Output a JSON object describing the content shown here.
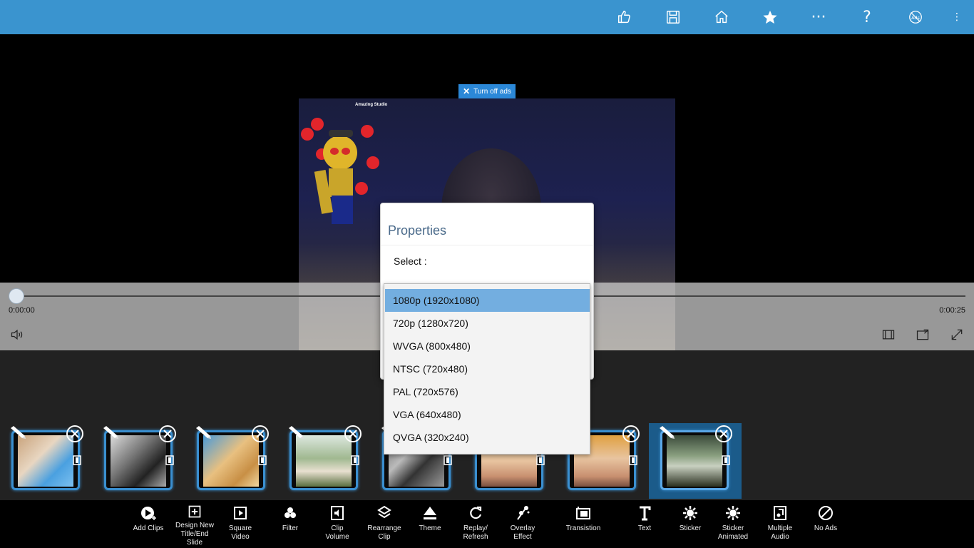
{
  "titlebar": {
    "buttons": [
      "like",
      "save",
      "home",
      "favorite",
      "more",
      "help",
      "ads-free",
      "overflow"
    ],
    "more_text": "···",
    "help_text": "?",
    "overflow_text": "⋮"
  },
  "stage": {
    "ads_button_label": "Turn off ads",
    "sticker_label": "Amazing Studio"
  },
  "player": {
    "time_current": "0:00:00",
    "time_total": "0:00:25"
  },
  "dialog": {
    "title": "Properties",
    "select_label": "Select :",
    "options": [
      "1080p (1920x1080)",
      "720p (1280x720)",
      "WVGA (800x480)",
      "NTSC (720x480)",
      "PAL (720x576)",
      "VGA (640x480)",
      "QVGA (320x240)"
    ],
    "selected_index": 0
  },
  "timeline": {
    "clip_count": 8,
    "selected_index": 7
  },
  "toolbar": {
    "items": [
      {
        "label": "Add Clips"
      },
      {
        "label": "Design New\nTitle/End\nSlide"
      },
      {
        "label": "Square\nVideo"
      },
      {
        "label": "Filter"
      },
      {
        "label": "Clip\nVolume"
      },
      {
        "label": "Rearrange\nClip"
      },
      {
        "label": "Theme"
      },
      {
        "label": "Replay/\nRefresh"
      },
      {
        "label": "Overlay\nEffect"
      },
      {
        "label": "Transistion"
      },
      {
        "label": "Text"
      },
      {
        "label": "Sticker"
      },
      {
        "label": "Sticker\nAnimated"
      },
      {
        "label": "Multiple\nAudio"
      },
      {
        "label": "No Ads"
      }
    ]
  },
  "colors": {
    "titlebar": "#3a94cf",
    "accent": "#3a8fd0",
    "selected_option": "#73aee0"
  }
}
